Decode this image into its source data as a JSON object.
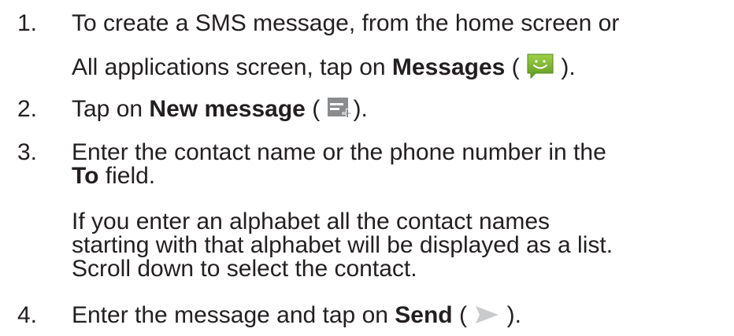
{
  "steps": [
    {
      "number": "1.",
      "lines": [
        {
          "text": "To create a SMS message, from the home screen or"
        },
        {
          "pre": "All applications screen, tap on ",
          "bold": "Messages",
          "open": " (",
          "icon": "messages-icon",
          "close": " )."
        }
      ]
    },
    {
      "number": "2.",
      "lines": [
        {
          "pre": "Tap on ",
          "bold": "New message",
          "open": " (",
          "icon": "new-message-icon",
          "close": ")."
        }
      ]
    },
    {
      "number": "3.",
      "lines": [
        {
          "text": "Enter the contact name or the phone number in the"
        },
        {
          "bold": "To",
          "post": " field."
        },
        {
          "text": "If you enter an alphabet all the contact names"
        },
        {
          "text": "starting with that alphabet will be displayed as a list."
        },
        {
          "text": "Scroll down to select the contact."
        }
      ]
    },
    {
      "number": "4.",
      "lines": [
        {
          "pre": "Enter the message and tap on ",
          "bold": "Send",
          "open": " (",
          "icon": "send-icon",
          "close": " )."
        }
      ]
    }
  ],
  "colors": {
    "text": "#231f20",
    "messages_icon_green": "#7cb52e",
    "new_message_icon_gray": "#8a8c8e",
    "send_icon_gray": "#c9cacc"
  }
}
